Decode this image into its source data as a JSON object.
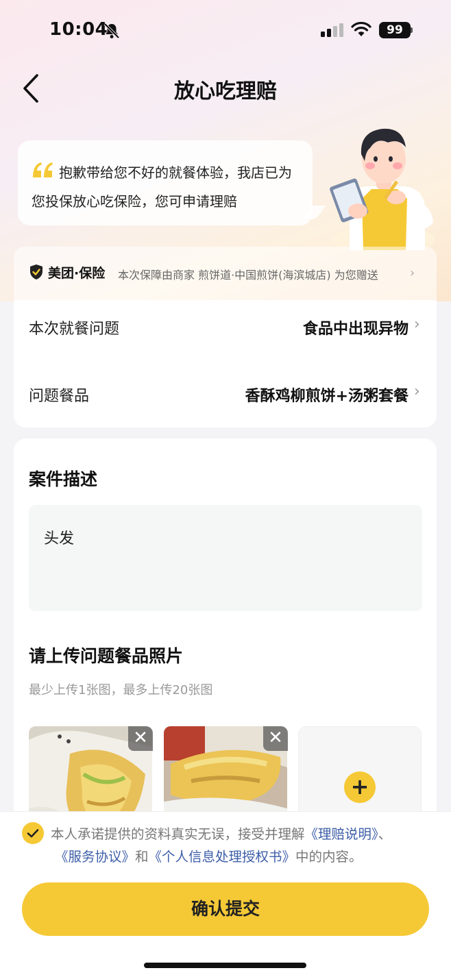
{
  "status_bar": {
    "time": "10:04",
    "battery": "99"
  },
  "nav": {
    "title": "放心吃理赔"
  },
  "bubble": {
    "text": "抱歉带给您不好的就餐体验，我店已为您投保放心吃保险，您可申请理赔"
  },
  "insurance": {
    "brand": "美团·保险",
    "description": "本次保障由商家 煎饼道·中国煎饼(海滨城店) 为您赠送"
  },
  "claim": {
    "rows": [
      {
        "label": "本次就餐问题",
        "value": "食品中出现异物"
      },
      {
        "label": "问题餐品",
        "value": "香酥鸡柳煎饼+汤粥套餐"
      }
    ]
  },
  "case": {
    "title": "案件描述",
    "description": "头发"
  },
  "upload": {
    "title": "请上传问题餐品照片",
    "hint": "最少上传1张图，最多上传20张图",
    "remove_symbol": "✕",
    "add_symbol": "+"
  },
  "agreement": {
    "text_before": "本人承诺提供的资料真实无误，接受并理解",
    "link1": "《理赔说明》",
    "sep": "、",
    "link2": "《服务协议》",
    "and": "和",
    "link3": "《个人信息处理授权书》",
    "text_after": "中的内容。",
    "checked": true
  },
  "submit": {
    "label": "确认提交"
  },
  "colors": {
    "accent": "#f5c936",
    "link": "#3d5ea8"
  }
}
